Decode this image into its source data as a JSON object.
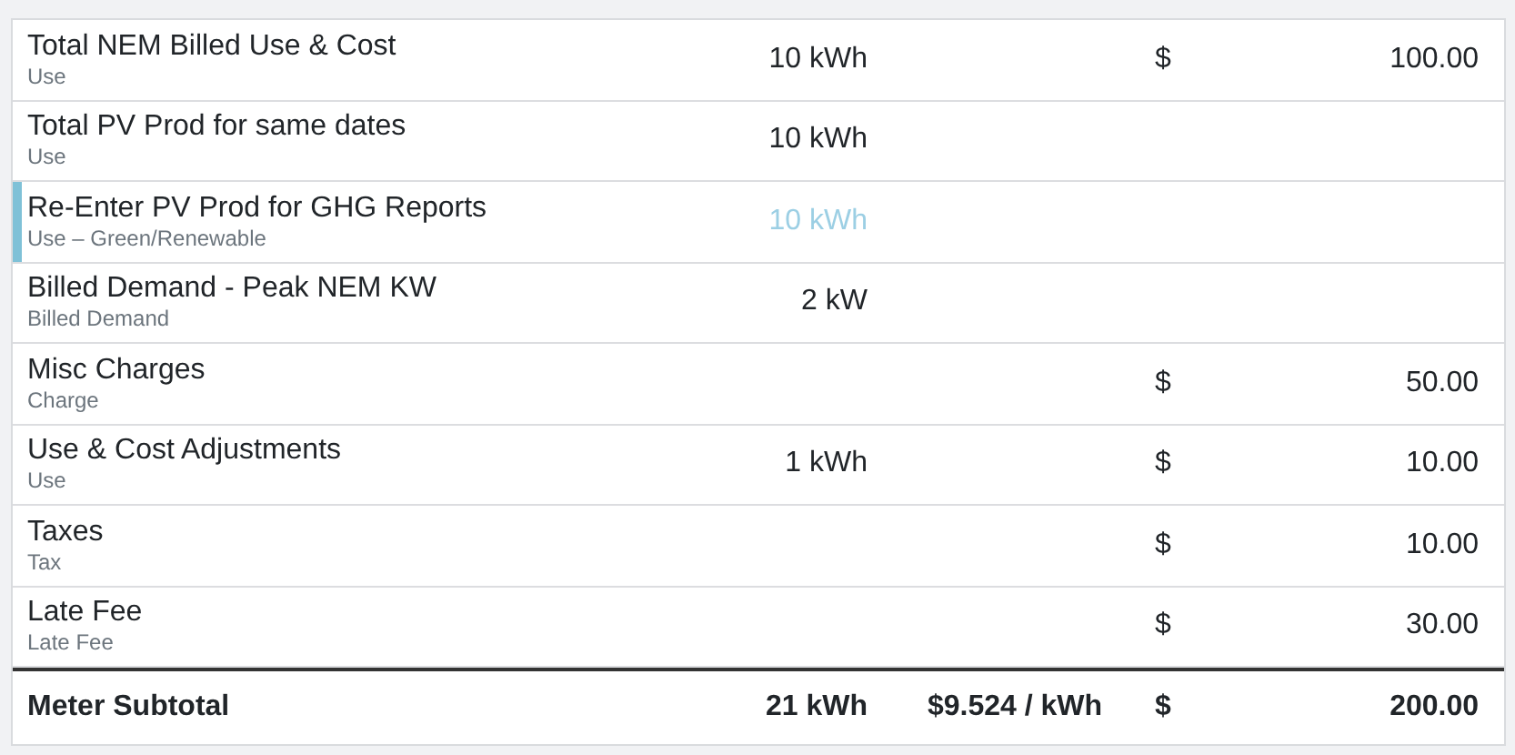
{
  "rows": [
    {
      "name": "Total NEM Billed Use & Cost",
      "type": "Use",
      "quantity": "10 kWh",
      "currency": "$",
      "amount": "100.00",
      "highlighted": false
    },
    {
      "name": "Total PV Prod for same dates",
      "type": "Use",
      "quantity": "10 kWh",
      "highlighted": false
    },
    {
      "name": "Re-Enter PV Prod for GHG Reports",
      "type": "Use – Green/Renewable",
      "quantity": "10 kWh",
      "highlighted": true
    },
    {
      "name": "Billed Demand - Peak NEM KW",
      "type": "Billed Demand",
      "quantity": "2 kW",
      "highlighted": false
    },
    {
      "name": "Misc Charges",
      "type": "Charge",
      "currency": "$",
      "amount": "50.00",
      "highlighted": false
    },
    {
      "name": "Use & Cost Adjustments",
      "type": "Use",
      "quantity": "1 kWh",
      "currency": "$",
      "amount": "10.00",
      "highlighted": false
    },
    {
      "name": "Taxes",
      "type": "Tax",
      "currency": "$",
      "amount": "10.00",
      "highlighted": false
    },
    {
      "name": "Late Fee",
      "type": "Late Fee",
      "currency": "$",
      "amount": "30.00",
      "highlighted": false
    }
  ],
  "subtotal": {
    "label": "Meter Subtotal",
    "quantity": "21 kWh",
    "rate": "$9.524 / kWh",
    "currency": "$",
    "amount": "200.00"
  }
}
